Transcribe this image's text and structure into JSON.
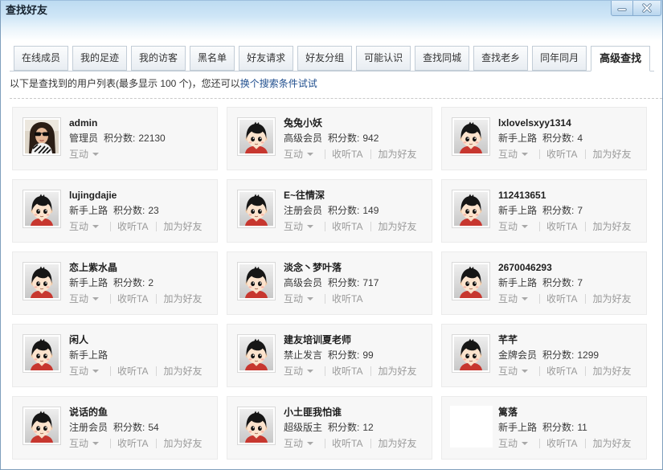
{
  "window": {
    "title": "查找好友",
    "controls": [
      "minimize-icon",
      "close-icon"
    ]
  },
  "theme": {
    "link": "#22508f",
    "title_bar": "#bddbf1",
    "card_bg": "#f7f7f7"
  },
  "tabs": [
    {
      "label": "在线成员"
    },
    {
      "label": "我的足迹"
    },
    {
      "label": "我的访客"
    },
    {
      "label": "黑名单"
    },
    {
      "label": "好友请求"
    },
    {
      "label": "好友分组"
    },
    {
      "label": "可能认识"
    },
    {
      "label": "查找同城"
    },
    {
      "label": "查找老乡"
    },
    {
      "label": "同年同月"
    },
    {
      "label": "高级查找",
      "active": true
    }
  ],
  "notice": {
    "text": "以下是查找到的用户列表(最多显示 100 个)，您还可以",
    "link": "换个搜索条件试试"
  },
  "labels": {
    "score": "积分数:"
  },
  "users": [
    {
      "name": "admin",
      "group": "管理员",
      "score": 22130,
      "avatar": "photo-avatar",
      "actions": [
        "互动"
      ]
    },
    {
      "name": "兔兔小妖",
      "group": "高级会员",
      "score": 942,
      "avatar": "default-avatar",
      "actions": [
        "互动",
        "收听TA",
        "加为好友"
      ]
    },
    {
      "name": "lxlovelsxyy1314",
      "group": "新手上路",
      "score": 4,
      "avatar": "default-avatar",
      "actions": [
        "互动",
        "收听TA",
        "加为好友"
      ]
    },
    {
      "name": "lujingdajie",
      "group": "新手上路",
      "score": 23,
      "avatar": "default-avatar",
      "actions": [
        "互动",
        "收听TA",
        "加为好友"
      ]
    },
    {
      "name": "E~往情深",
      "group": "注册会员",
      "score": 149,
      "avatar": "default-avatar",
      "actions": [
        "互动",
        "收听TA",
        "加为好友"
      ]
    },
    {
      "name": "112413651",
      "group": "新手上路",
      "score": 7,
      "avatar": "default-avatar",
      "actions": [
        "互动",
        "收听TA",
        "加为好友"
      ]
    },
    {
      "name": "恋上紫水晶",
      "group": "新手上路",
      "score": 2,
      "avatar": "default-avatar",
      "actions": [
        "互动",
        "收听TA",
        "加为好友"
      ]
    },
    {
      "name": "淡念丶梦叶落",
      "group": "高级会员",
      "score": 717,
      "avatar": "default-avatar",
      "actions": [
        "互动",
        "收听TA"
      ]
    },
    {
      "name": "2670046293",
      "group": "新手上路",
      "score": 7,
      "avatar": "default-avatar",
      "actions": [
        "互动",
        "收听TA",
        "加为好友"
      ]
    },
    {
      "name": "闲人",
      "group": "新手上路",
      "avatar": "default-avatar",
      "actions": [
        "互动",
        "收听TA",
        "加为好友"
      ]
    },
    {
      "name": "建友培训夏老师",
      "group": "禁止发言",
      "score": 99,
      "avatar": "default-avatar",
      "actions": [
        "互动",
        "收听TA",
        "加为好友"
      ]
    },
    {
      "name": "芊芊",
      "group": "金牌会员",
      "score": 1299,
      "avatar": "default-avatar",
      "actions": [
        "互动",
        "收听TA",
        "加为好友"
      ]
    },
    {
      "name": "说话的鱼",
      "group": "注册会员",
      "score": 54,
      "avatar": "default-avatar",
      "actions": [
        "互动",
        "收听TA",
        "加为好友"
      ]
    },
    {
      "name": "小土匪我怕谁",
      "group": "超级版主",
      "score": 12,
      "avatar": "default-avatar",
      "actions": [
        "互动",
        "收听TA",
        "加为好友"
      ]
    },
    {
      "name": "篱落",
      "group": "新手上路",
      "score": 11,
      "avatar": "empty-avatar",
      "actions": [
        "互动",
        "收听TA",
        "加为好友"
      ]
    }
  ]
}
